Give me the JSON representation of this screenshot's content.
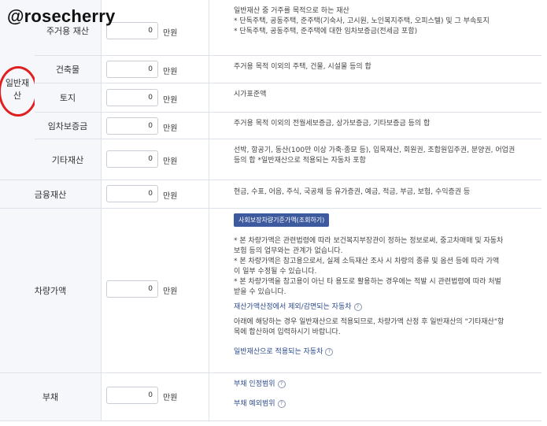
{
  "watermark": "@rosecherry",
  "group": {
    "title_line1": "일반재",
    "title_line2": "산"
  },
  "unit_label": "만원",
  "rows": [
    {
      "label": "주거용 재산",
      "value": "0",
      "desc": [
        "일반재산 중 거주를 목적으로 하는 재산",
        "* 단독주택, 공동주택, 준주택(기숙사, 고시원, 노인복지주택, 오피스텔) 및 그 부속토지",
        "* 단독주택, 공동주택, 준주택에 대한 임차보증금(전세금 포함)"
      ]
    },
    {
      "label": "건축물",
      "value": "0",
      "desc": [
        "주거용 목적 이외의 주택, 건물, 시설물 등의 합"
      ]
    },
    {
      "label": "토지",
      "value": "0",
      "desc": [
        "시가표준액"
      ]
    },
    {
      "label": "임차보증금",
      "value": "0",
      "desc": [
        "주거용 목적 이외의 전월세보증금, 상가보증금, 기타보증금 등의 합"
      ]
    },
    {
      "label": "기타재산",
      "value": "0",
      "desc": [
        "선박, 항공기, 동산(100만 이상 가축·종묘 등), 입목재산, 회원권, 조합원입주권, 분양권, 어업권",
        "등의 합 *일반재산으로 적용되는 자동차 포함"
      ]
    },
    {
      "label": "금융재산",
      "value": "0",
      "desc": [
        "현금, 수표, 어음, 주식, 국공채 등 유가증권, 예금, 적금, 부금, 보험, 수익증권 등"
      ]
    },
    {
      "label": "차량가액",
      "value": "0",
      "button": "사회보장차량기준가액(조회하기)",
      "desc": [
        "* 본 차량가액은 관련법령에 따라 보건복지부장관이 정하는 정보로써, 중고차매매 및 자동차",
        "보험 등의 업무와는 관계가 없습니다.",
        "* 본 차량가액은 참고용으로서, 실제 소득재산 조사 시 차량의 종류 및 옵션 등에 따라 가액",
        "이 일부 수정될 수 있습니다.",
        "* 본 차량가액을 참고용이 아닌 타 용도로 활용하는 경우에는 적발 시 관련법령에 따라 처벌",
        "받을 수 있습니다."
      ],
      "link1": "재산가액산정에서 제외/감면되는 자동차",
      "desc2": [
        "아래에 해당하는 경우 일반재산으로 적용되므로, 차량가액 산정 후 일반재산의 \"기타재산\"항",
        "목에 합산하여 입력하시기 바랍니다."
      ],
      "link2": "일반재산으로 적용되는 자동차"
    },
    {
      "label": "부채",
      "value": "0",
      "link1": "부채 인정범위",
      "link2": "부채 예외범위"
    }
  ],
  "help_icon": "question-circle-icon"
}
